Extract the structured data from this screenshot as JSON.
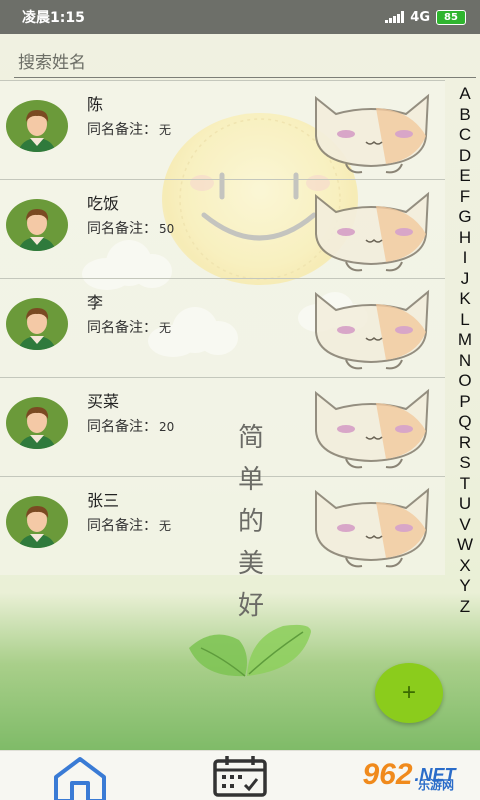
{
  "status_bar": {
    "time": "凌晨1:15",
    "network": "4G",
    "battery": "85"
  },
  "search": {
    "placeholder": "搜索姓名"
  },
  "contacts": [
    {
      "name": "陈",
      "note_label": "同名备注：",
      "note_value": "无"
    },
    {
      "name": "吃饭",
      "note_label": "同名备注：",
      "note_value": "50"
    },
    {
      "name": "李",
      "note_label": "同名备注：",
      "note_value": "无"
    },
    {
      "name": "买菜",
      "note_label": "同名备注：",
      "note_value": "20"
    },
    {
      "name": "张三",
      "note_label": "同名备注：",
      "note_value": "无"
    }
  ],
  "alphabet_index": [
    "A",
    "B",
    "C",
    "D",
    "E",
    "F",
    "G",
    "H",
    "I",
    "J",
    "K",
    "L",
    "M",
    "N",
    "O",
    "P",
    "Q",
    "R",
    "S",
    "T",
    "U",
    "V",
    "W",
    "X",
    "Y",
    "Z"
  ],
  "decor_text": [
    "简",
    "单",
    "的",
    "美",
    "好"
  ],
  "fab": {
    "label": "+"
  },
  "bottom_nav": [
    {
      "icon": "home-icon"
    },
    {
      "icon": "calendar-icon"
    }
  ],
  "watermark": {
    "number": "962",
    "suffix": ".NET",
    "text": "乐游网"
  },
  "colors": {
    "accent": "#8bcc1c",
    "nav_icon": "#3a7bd5",
    "status_bar": "#6d6f69"
  }
}
